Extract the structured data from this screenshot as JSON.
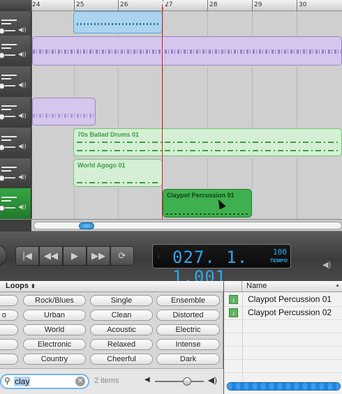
{
  "timeline": {
    "bar_numbers": [
      "24",
      "25",
      "26",
      "27",
      "28",
      "29",
      "30"
    ],
    "regions": {
      "ballad_drums": "70s Ballad Drums 01",
      "world_agogo": "World Agogo 01",
      "claypot": "Claypot Percussion 01"
    }
  },
  "transport": {
    "counter": "027. 1. 1.001",
    "tempo_value": "100",
    "tempo_label": "TEMPO",
    "icons": {
      "go_to_start": "skip-back-icon",
      "rewind": "rewind-icon",
      "play": "play-icon",
      "forward": "fast-forward-icon",
      "cycle": "cycle-icon"
    }
  },
  "loop_browser": {
    "header": "Loops",
    "keywords": [
      [
        "",
        "Rock/Blues",
        "Single",
        "Ensemble"
      ],
      [
        "o",
        "Urban",
        "Clean",
        "Distorted"
      ],
      [
        "",
        "World",
        "Acoustic",
        "Electric"
      ],
      [
        "",
        "Electronic",
        "Relaxed",
        "Intense"
      ],
      [
        "",
        "Country",
        "Cheerful",
        "Dark"
      ]
    ],
    "search_value": "clay",
    "items_count": "2 items"
  },
  "results": {
    "column_name": "Name",
    "rows": [
      "Claypot Percussion 01",
      "Claypot Percussion 02"
    ]
  },
  "colors": {
    "accent_blue": "#2fa7ef",
    "playhead": "#e02020",
    "green_region": "#3fb04f"
  }
}
